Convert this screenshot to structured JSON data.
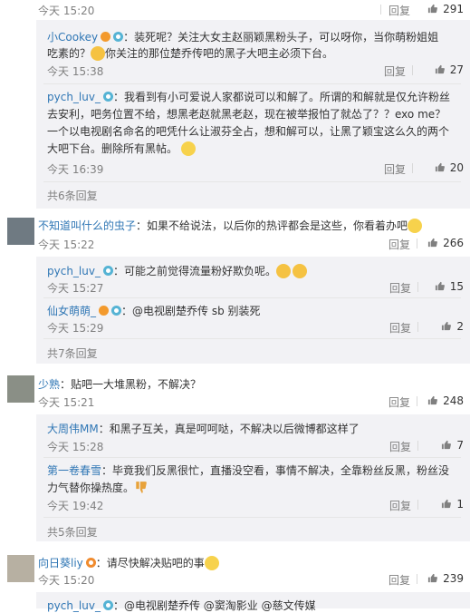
{
  "labels": {
    "reply": "回复",
    "show_more_prefix": "共",
    "show_more_suffix": "条回复"
  },
  "top_row": {
    "time": "今天 15:20",
    "likes": "291"
  },
  "replies_block1": [
    {
      "nick": "小Cookey",
      "line1": "：装死呢？关注大女主赵丽颖黑粉头子，可以呀你，当你萌粉姐姐",
      "line2a": "吃素的？",
      "line2b": "你关注的那位楚乔传吧的黑子大吧主必须下台。",
      "time": "今天 15:38",
      "likes": "27"
    },
    {
      "nick": "pych_luv_",
      "lines": [
        "：我看到有小可爱说人家都说可以和解了。所谓的和解就是仅允许粉丝",
        "去安利，吧务位置不给，想黑老赵就黑老赵，现在被举报怕了就怂了？？exo me？",
        "一个以电视剧名命名的吧凭什么让淑芬全占，想和解可以，让黑了颖宝这么久的两个",
        "大吧下台。删除所有黑帖。"
      ],
      "time": "今天 16:39",
      "likes": "20"
    }
  ],
  "more1": "共6条回复",
  "comment2": {
    "nick": "不知道叫什么的虫子",
    "text": "：如果不给说法，以后你的热评都会是这些，你看着办吧",
    "time": "今天 15:22",
    "likes": "266"
  },
  "replies_block2": [
    {
      "nick": "pych_luv_",
      "text": "：可能之前觉得流量粉好欺负呢。",
      "time": "今天 15:27",
      "likes": "15"
    },
    {
      "nick": "仙女萌萌_",
      "text": "：@电视剧楚乔传 sb 别装死",
      "time": "今天 15:29",
      "likes": "2"
    }
  ],
  "more2": "共7条回复",
  "comment3": {
    "nick": "少熟",
    "text": "：贴吧一大堆黑粉，不解决？",
    "time": "今天 15:21",
    "likes": "248"
  },
  "replies_block3": [
    {
      "nick": "大周伟MM",
      "text": "：和黑子互关，真是呵呵哒，不解决以后微博都这样了",
      "time": "今天 15:28",
      "likes": "7"
    },
    {
      "nick": "第一卷春雪",
      "line1": "：毕竟我们反黑很忙，直播没空看，事情不解决，全靠粉丝反黑，粉丝没",
      "line2": "力气替你操热度。",
      "time": "今天 19:42",
      "likes": "1"
    }
  ],
  "more3": "共5条回复",
  "comment4": {
    "nick": "向日葵liy",
    "text": "：请尽快解决贴吧的事",
    "time": "今天 15:20",
    "likes": "239"
  },
  "bottom_partial": {
    "nick": "pych_luv_",
    "text": "：@电视剧楚乔传 @窦淘影业 @慈文传媒"
  },
  "icons": [
    "thumb-icon",
    "verified-icon",
    "crown-icon",
    "smile-emoji",
    "thumbs-down-emoji",
    "scared-emoji"
  ]
}
